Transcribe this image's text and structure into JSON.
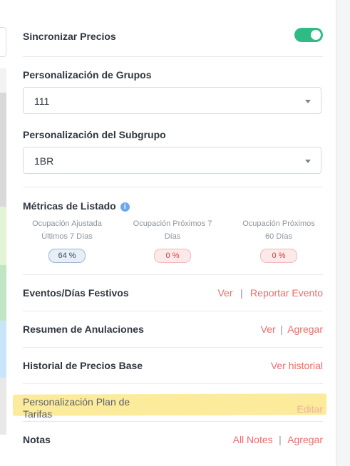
{
  "sync": {
    "label": "Sincronizar Precios",
    "enabled": true
  },
  "groups": {
    "label": "Personalización de Grupos",
    "value": "111"
  },
  "subgroup": {
    "label": "Personalización del Subgrupo",
    "value": "1BR"
  },
  "metrics": {
    "title": "Métricas de Listado",
    "info_icon": "info-icon",
    "items": [
      {
        "label_line1": "Ocupación Ajustada",
        "label_line2": "Últimos 7 Días",
        "value": "64 %",
        "tone": "blue"
      },
      {
        "label_line1": "Ocupación Próximos 7",
        "label_line2": "Días",
        "value": "0 %",
        "tone": "red"
      },
      {
        "label_line1": "Ocupación Próximos",
        "label_line2": "60 Días",
        "value": "0 %",
        "tone": "red"
      }
    ]
  },
  "events": {
    "label": "Eventos/Días Festivos",
    "view": "Ver",
    "separator": "|",
    "report": "Reportar Evento"
  },
  "cancellations": {
    "label": "Resumen de Anulaciones",
    "view": "Ver",
    "separator": "|",
    "add": "Agregar"
  },
  "history": {
    "label": "Historial de Precios Base",
    "view": "Ver historial"
  },
  "rate_plan": {
    "label_line1": "Personalización Plan de",
    "label_line2": "Tarifas",
    "edit": "Editar"
  },
  "notes": {
    "label": "Notas",
    "all": "All Notes",
    "separator": "|",
    "add": "Agregar"
  },
  "colors": {
    "accent_link": "#ee6b6b",
    "toggle_on": "#2fbb85",
    "highlight": "#fce88a"
  }
}
